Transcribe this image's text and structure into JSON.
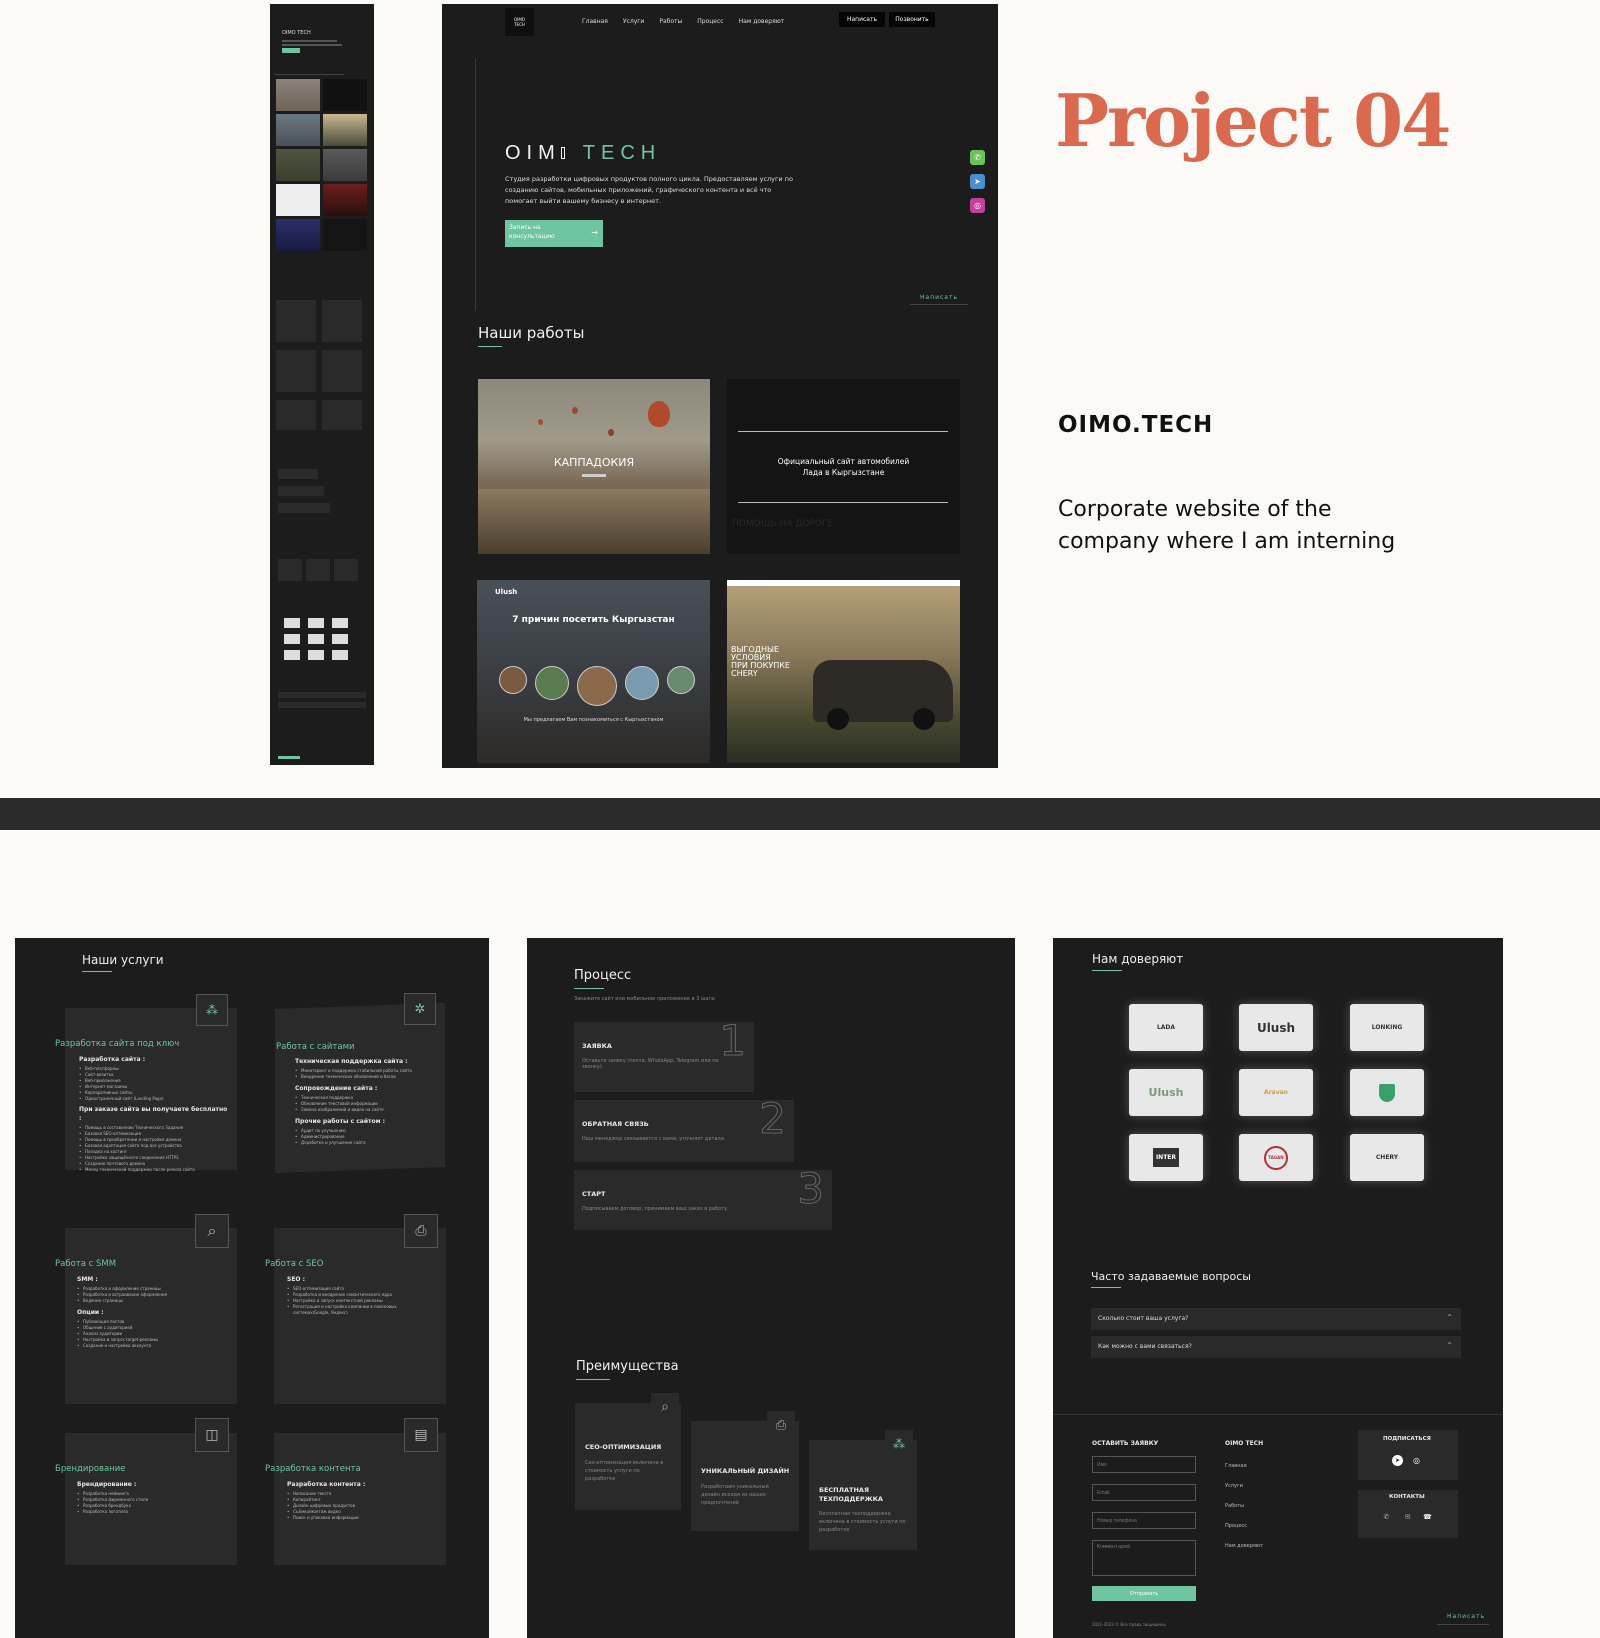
{
  "project": {
    "title": "Project 04",
    "name": "OIMO.TECH",
    "description_line1": "Corporate website of the",
    "description_line2": "company where I am interning"
  },
  "colors": {
    "page_bg": "#fbfaf6",
    "accent": "#d9694f",
    "site_green": "#6fc5a0",
    "site_dark": "#1c1c1c"
  },
  "nav": {
    "logo_line1": "OIMO",
    "logo_line2": "TECH",
    "items": [
      "Главная",
      "Услуги",
      "Работы",
      "Процесс",
      "Нам доверяют"
    ],
    "write_button": "Написать",
    "call_button": "Позвонить"
  },
  "hero": {
    "brand_left": "OIM",
    "brand_right": "TECH",
    "description": "Студия разработки цифровых продуктов полного цикла. Предоставляем услуги по созданию сайтов, мобильных приложений, графического контента и всё что помогает выйти вашему бизнесу в интернет.",
    "cta_line1": "Запись на",
    "cta_line2": "консультацию",
    "write_link": "Написать",
    "social_icons": [
      "whatsapp-icon",
      "telegram-icon",
      "instagram-icon"
    ]
  },
  "works": {
    "heading": "Наши работы",
    "cards": [
      {
        "label": "КАППАДОКИЯ"
      },
      {
        "line1": "Официальный сайт автомобилей",
        "line2": "Лада в Кыргызстане",
        "sub": "ПОМОЩЬ НА ДОРОГЕ"
      },
      {
        "brand": "Ulush",
        "title": "7 причин посетить Кыргызстан",
        "footer": "Мы предлагаем Вам познакомиться с Кыргызстаном"
      },
      {
        "line1": "ВЫГОДНЫЕ",
        "line2": "УСЛОВИЯ",
        "line3": "ПРИ ПОКУПКЕ",
        "line4": "CHERY"
      }
    ]
  },
  "services": {
    "heading": "Наши услуги",
    "cards": [
      {
        "title": "Разработка сайта под ключ",
        "sub": "Разработка сайта :",
        "items": [
          "Веб-платформы",
          "Сайт-визитка",
          "Веб-приложения",
          "Интернет-магазины",
          "Корпоративные сайты",
          "Одностраничный сайт (Landing Page)"
        ],
        "sub2": "При заказе сайта вы получаете бесплатно :",
        "items2": [
          "Помощь в составлении Технического Задания",
          "Базовая SEO-оптимизация",
          "Помощь в приобретении и настройке домена",
          "Базовая адаптация сайта под все устройства",
          "Поездка на хостинг",
          "Настройка защищённого соединения HTTPS",
          "Создание почтового домена",
          "Месяц технической поддержки после релиза сайта"
        ]
      },
      {
        "title": "Работа с сайтами",
        "sub": "Техническая поддержка сайта :",
        "items": [
          "Мониторинг и поддержка стабильной работы сайта",
          "Внедрение технических обновлений и багов"
        ],
        "sub2": "Сопровождение сайта :",
        "items2": [
          "Техническая поддержка",
          "Обновление текстовой информации",
          "Замена изображений и видео на сайте"
        ],
        "sub3": "Прочие работы с сайтом :",
        "items3": [
          "Аудит по улучшению",
          "Администрирование",
          "Доработка и улучшение сайта"
        ]
      },
      {
        "title": "Работа с SMM",
        "sub": "SMM :",
        "items": [
          "Разработка и оформление страницы",
          "Разработка и встраивание оформления",
          "Ведение страницы"
        ],
        "sub2": "Опции :",
        "items2": [
          "Публикация постов",
          "Общение с аудиторией",
          "Анализ аудитории",
          "Настройка и запуск target-рекламы",
          "Создание и настройка аккаунта"
        ]
      },
      {
        "title": "Работа с SEO",
        "sub": "SEO :",
        "items": [
          "SEO-оптимизация сайта",
          "Разработка и внедрение семантического ядра",
          "Настройка и запуск контекстной рекламы",
          "Регистрация и настройка компании в поисковых системах(Google, Яндекс)"
        ]
      },
      {
        "title": "Брендирование",
        "sub": "Брендирование :",
        "items": [
          "Разработка нейминга",
          "Разработка фирменного стиля",
          "Разработка брендбука",
          "Разработка логотипа"
        ]
      },
      {
        "title": "Разработка контента",
        "sub": "Разработка контента :",
        "items": [
          "Написание текста",
          "Копирайтинг",
          "Дизайн цифровых продуктов",
          "Съёмка/монтаж видео",
          "Поиск и упаковка информации"
        ]
      }
    ]
  },
  "process": {
    "heading": "Процесс",
    "subtitle": "Закажите сайт или мобильное приложение в 3 шага:",
    "steps": [
      {
        "num": "1",
        "title": "ЗАЯВКА",
        "text": "Оставьте заявку (почта, WhatsApp, Telegram или по звонку)."
      },
      {
        "num": "2",
        "title": "ОБРАТНАЯ СВЯЗЬ",
        "text": "Наш менеджер связывается с вами, уточняет детали."
      },
      {
        "num": "3",
        "title": "СТАРТ",
        "text": "Подписываем договор, принимаем ваш заказ в работу."
      }
    ]
  },
  "advantages": {
    "heading": "Преимущества",
    "cards": [
      {
        "title": "СЕО-ОПТИМИЗАЦИЯ",
        "text": "Сео-оптимизация включена в стоимость услуги по разработке"
      },
      {
        "title": "УНИКАЛЬНЫЙ ДИЗАЙН",
        "text": "Разработаем уникальный дизайн исходя из ваших предпочтений"
      },
      {
        "title_line1": "БЕСПЛАТНАЯ",
        "title_line2": "ТЕХПОДДЕРЖКА",
        "text": "Бесплатная техподдержка включена в стоимость услуги по разработке"
      }
    ]
  },
  "trust": {
    "heading": "Нам доверяют",
    "logos": [
      "LADA",
      "Ulush",
      "LONKING",
      "Ulush",
      "Aravan",
      "shield",
      "INTER",
      "TAGAN",
      "CHERY"
    ]
  },
  "faq": {
    "heading": "Часто задаваемые вопросы",
    "items": [
      "Сколько стоит ваша услуга?",
      "Как можно с вами связаться?"
    ]
  },
  "footer": {
    "form_title": "ОСТАВИТЬ ЗАЯВКУ",
    "placeholders": {
      "name": "Имя",
      "email": "Email",
      "phone": "Номер телефона",
      "comment": "Комментарий"
    },
    "submit": "Отправить",
    "company": "OIMO TECH",
    "links": [
      "Главная",
      "Услуги",
      "Работы",
      "Процесс",
      "Нам доверяют"
    ],
    "subscribe": "ПОДПИСАТЬСЯ",
    "contacts": "КОНТАКТЫ",
    "copyright": "2021-2023 © Все права защищены",
    "write_link": "Написать"
  }
}
